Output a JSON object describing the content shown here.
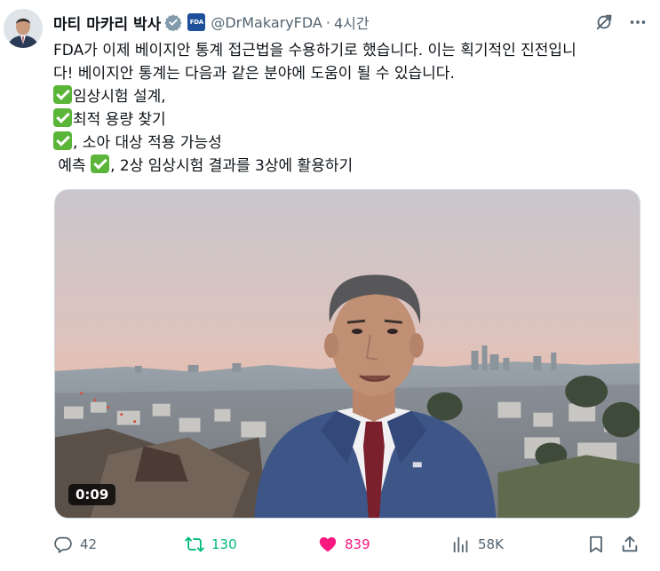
{
  "tweet": {
    "author_name": "마티 마카리 박사",
    "handle": "@DrMakaryFDA",
    "separator": "·",
    "time": "4시간",
    "org_badge_text": "FDA",
    "text_lines": [
      "FDA가 이제 베이지안 통계 접근법을 수용하기로 했습니다. 이는 획기적인 진전입니",
      "다! 베이지안 통계는 다음과 같은 분야에 도움이 될 수 있습니다."
    ],
    "list": {
      "item1": "임상시험 설계,",
      "item2": "최적 용량 찾기",
      "item3": ", 소아 대상 적용 가능성",
      "item4_prefix": " 예측 ",
      "item4": ", 2상 임상시험 결과를 3상에 활용하기"
    }
  },
  "media": {
    "duration": "0:09"
  },
  "stats": {
    "replies": "42",
    "retweets": "130",
    "likes": "839",
    "views": "58K"
  },
  "colors": {
    "verified": "#829aab",
    "retweet": "#00ba7c",
    "like": "#f91880",
    "secondary_text": "#536471",
    "check": "#5ab538",
    "org_badge": "#1d4f9a"
  },
  "icons": {
    "verified": "verified-badge-icon",
    "grok": "grok-icon",
    "more": "more-icon",
    "reply": "reply-icon",
    "retweet": "retweet-icon",
    "like": "heart-icon",
    "views": "views-icon",
    "bookmark": "bookmark-icon",
    "share": "share-icon"
  }
}
